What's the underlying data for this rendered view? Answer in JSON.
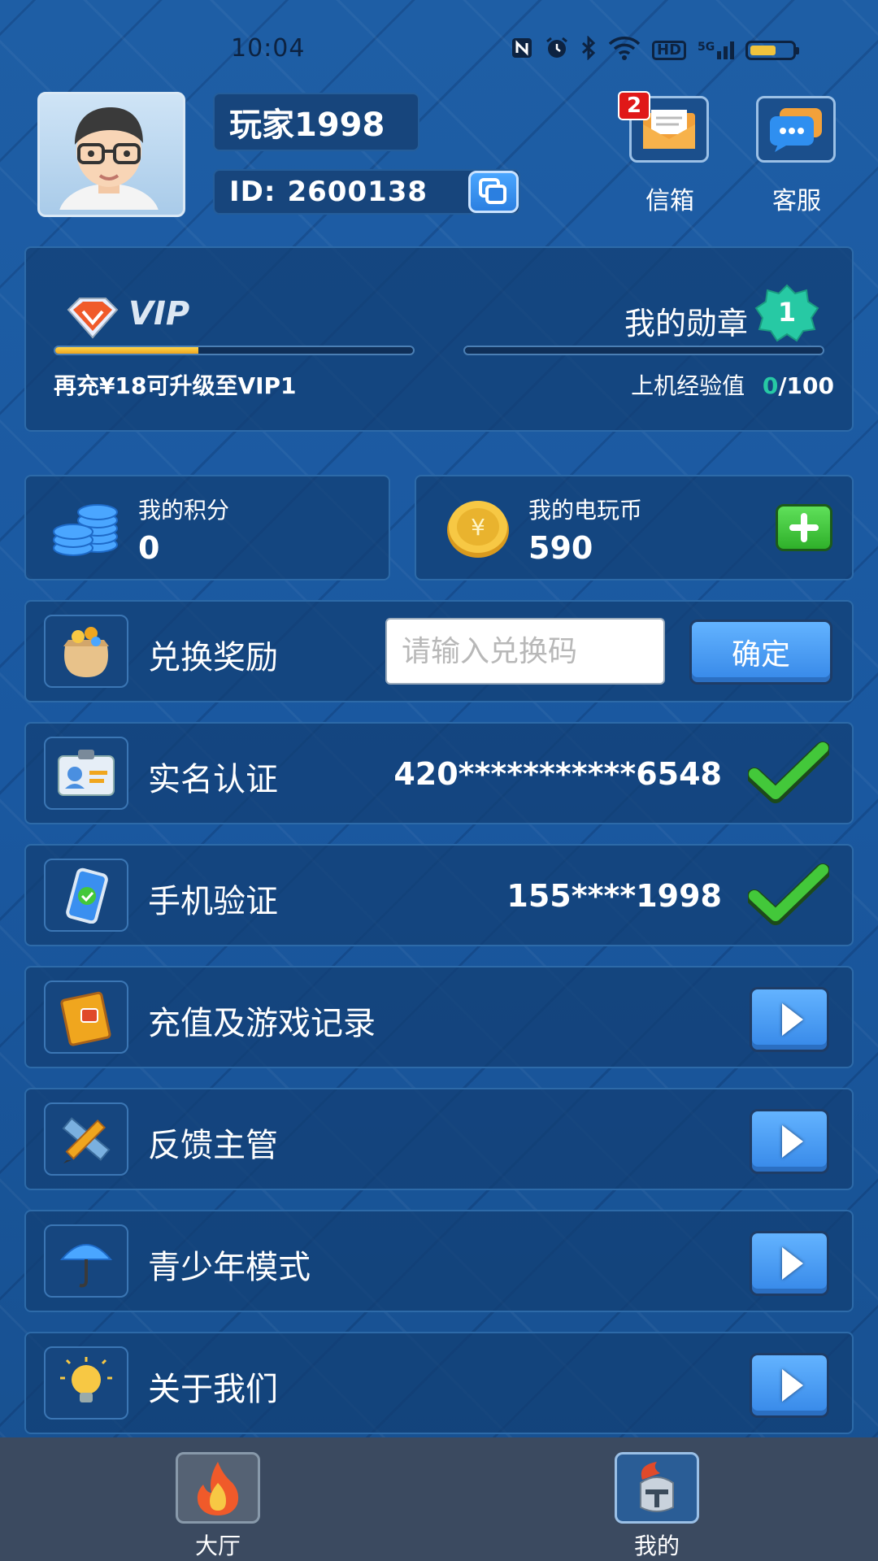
{
  "status_bar": {
    "time": "10:04",
    "icons": [
      "nfc-icon",
      "alarm-icon",
      "bluetooth-icon",
      "wifi-icon",
      "hd-icon",
      "signal-5g-icon",
      "battery-icon"
    ],
    "hd": "HD",
    "net": "5G"
  },
  "profile": {
    "name": "玩家1998",
    "id_label": "ID:",
    "id_value": "2600138"
  },
  "top_actions": {
    "mail_label": "信箱",
    "mail_badge": "2",
    "service_label": "客服"
  },
  "vip": {
    "title": "VIP",
    "progress": 0.4,
    "hint": "再充¥18可升级至VIP1",
    "medal_label": "我的勋章",
    "medal_level": "1",
    "exp_label": "上机经验值",
    "exp_current": "0",
    "exp_total": "/100",
    "exp_progress": 0
  },
  "points": {
    "label": "我的积分",
    "value": "0"
  },
  "coins": {
    "label": "我的电玩币",
    "value": "590"
  },
  "rows": [
    {
      "label": "兑换奖励",
      "placeholder": "请输入兑换码",
      "button": "确定"
    },
    {
      "label": "实名认证",
      "value": "420***********6548"
    },
    {
      "label": "手机验证",
      "value": "155****1998"
    },
    {
      "label": "充值及游戏记录"
    },
    {
      "label": "反馈主管"
    },
    {
      "label": "青少年模式"
    },
    {
      "label": "关于我们"
    }
  ],
  "bottom_nav": [
    {
      "label": "大厅"
    },
    {
      "label": "我的"
    }
  ],
  "colors": {
    "accent": "#3688e8",
    "progress": "#f0a61e",
    "check": "#43c83a",
    "badge": "#e01818"
  }
}
